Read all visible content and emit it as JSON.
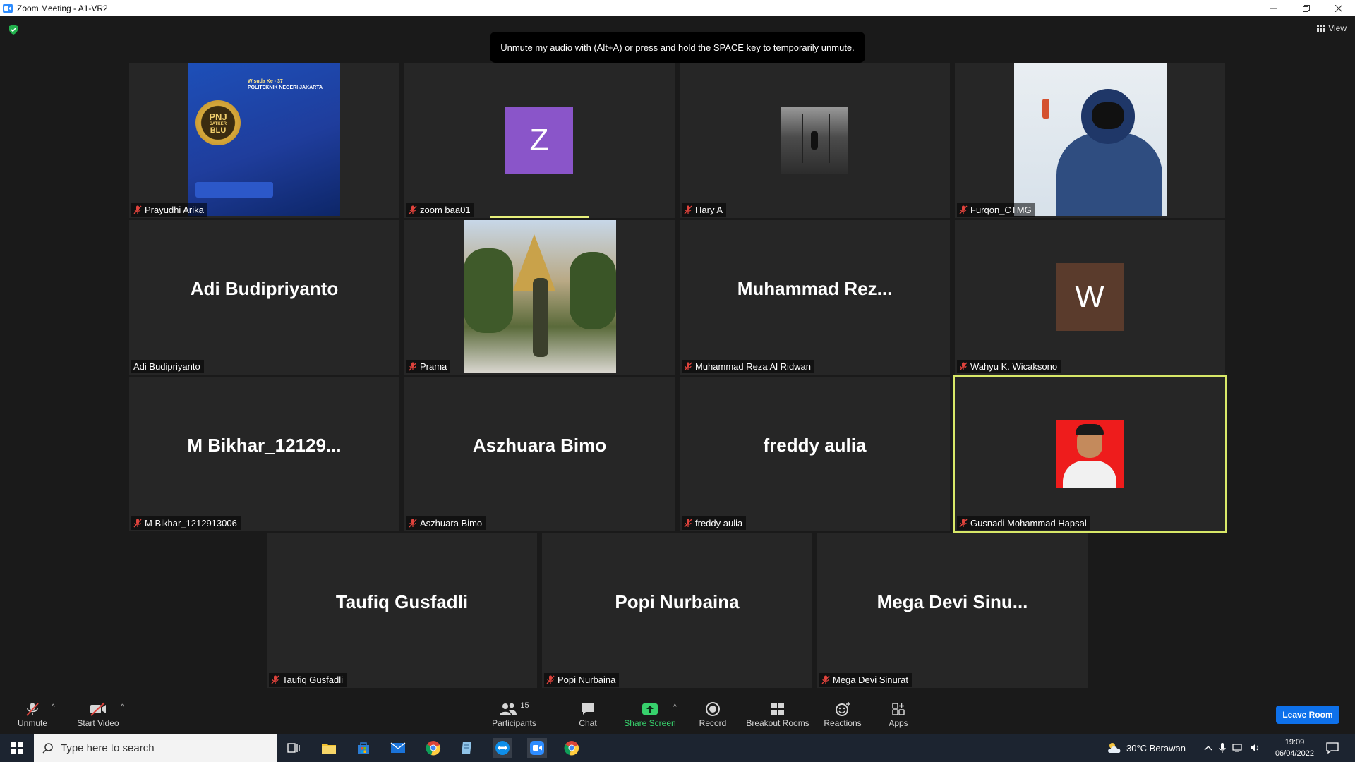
{
  "window": {
    "title": "Zoom Meeting - A1-VR2"
  },
  "meeting": {
    "view_label": "View",
    "toast": "Unmute my audio with (Alt+A) or press and hold the SPACE key to temporarily unmute."
  },
  "tiles": [
    {
      "name": "Prayudhi Arika",
      "muted": true
    },
    {
      "name": "zoom baa01",
      "muted": true,
      "avatar_letter": "Z"
    },
    {
      "name": "Hary A",
      "muted": true
    },
    {
      "name": "Furqon_CTMG",
      "muted": true
    },
    {
      "name": "Adi Budipriyanto",
      "muted": false,
      "display": "Adi Budipriyanto"
    },
    {
      "name": "Prama",
      "muted": true
    },
    {
      "name": "Muhammad Reza Al Ridwan",
      "muted": true,
      "display": "Muhammad  Rez..."
    },
    {
      "name": "Wahyu K. Wicaksono",
      "muted": true,
      "avatar_letter": "W"
    },
    {
      "name": "M Bikhar_1212913006",
      "muted": true,
      "display": "M  Bikhar_12129..."
    },
    {
      "name": "Aszhuara Bimo",
      "muted": true,
      "display": "Aszhuara Bimo"
    },
    {
      "name": "freddy aulia",
      "muted": true,
      "display": "freddy aulia"
    },
    {
      "name": "Gusnadi Mohammad Hapsal",
      "muted": true,
      "active_speaker": true
    },
    {
      "name": "Taufiq Gusfadli",
      "muted": true,
      "display": "Taufiq Gusfadli"
    },
    {
      "name": "Popi Nurbaina",
      "muted": true,
      "display": "Popi Nurbaina"
    },
    {
      "name": "Mega Devi Sinurat",
      "muted": true,
      "display": "Mega  Devi  Sinu..."
    }
  ],
  "poster": {
    "line1": "Wisuda Ke - 37",
    "line2": "POLITEKNIK NEGERI JAKARTA",
    "badge_top": "PNJ",
    "badge_mid": "SATKER",
    "badge_bottom": "BLU"
  },
  "controls": {
    "unmute": "Unmute",
    "start_video": "Start Video",
    "participants": "Participants",
    "participants_count": "15",
    "chat": "Chat",
    "share_screen": "Share Screen",
    "record": "Record",
    "breakout_rooms": "Breakout Rooms",
    "reactions": "Reactions",
    "apps": "Apps",
    "leave_room": "Leave Room"
  },
  "taskbar": {
    "search_placeholder": "Type here to search",
    "weather": "30°C  Berawan",
    "time": "19:09",
    "date": "06/04/2022"
  },
  "colors": {
    "accent_blue": "#0e71eb",
    "active_speaker": "#d8e868",
    "share_green": "#37d16c",
    "mute_red": "#e0433c"
  }
}
